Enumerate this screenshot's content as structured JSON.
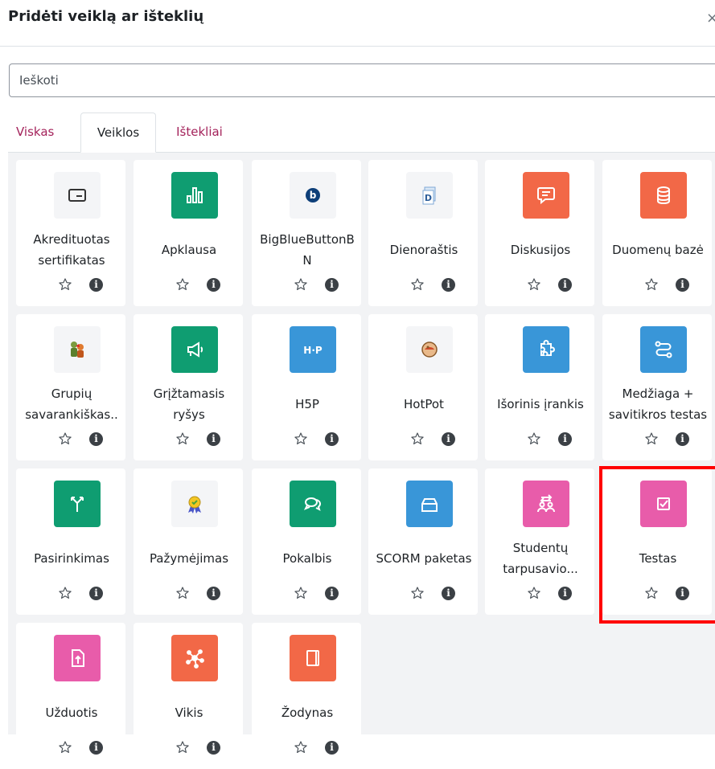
{
  "dialog": {
    "title": "Pridėti veiklą ar išteklių",
    "close_label": "×"
  },
  "search": {
    "placeholder": "Ieškoti"
  },
  "tabs": [
    {
      "label": "Viskas",
      "active": false
    },
    {
      "label": "Veiklos",
      "active": true
    },
    {
      "label": "Ištekliai",
      "active": false
    }
  ],
  "colors": {
    "accent_link": "#a4235b",
    "green": "#0f9d71",
    "blue": "#3996d8",
    "orange": "#f26847",
    "pink": "#e85caa",
    "grey": "#f4f5f7",
    "highlight": "#ff0000"
  },
  "activities": [
    {
      "label": "Akredituotas\nsertifikatas",
      "icon": "certificate-icon",
      "color": "grey"
    },
    {
      "label": "Apklausa",
      "icon": "bar-chart-icon",
      "color": "green"
    },
    {
      "label": "BigBlueButtonB\nN",
      "icon": "bigbluebutton-icon",
      "color": "grey"
    },
    {
      "label": "Dienoraštis",
      "icon": "journal-icon",
      "color": "grey"
    },
    {
      "label": "Diskusijos",
      "icon": "chat-bubble-icon",
      "color": "orange"
    },
    {
      "label": "Duomenų bazė",
      "icon": "database-icon",
      "color": "orange"
    },
    {
      "label": "Grupių\nsavarankiškas..",
      "icon": "group-people-icon",
      "color": "grey"
    },
    {
      "label": "Grįžtamasis\nryšys",
      "icon": "megaphone-icon",
      "color": "green"
    },
    {
      "label": "H5P",
      "icon": "h5p-icon",
      "color": "blue"
    },
    {
      "label": "HotPot",
      "icon": "hotpot-icon",
      "color": "grey"
    },
    {
      "label": "Išorinis įrankis",
      "icon": "puzzle-icon",
      "color": "blue"
    },
    {
      "label": "Medžiaga +\nsavitikros testas",
      "icon": "route-icon",
      "color": "blue"
    },
    {
      "label": "Pasirinkimas",
      "icon": "signpost-icon",
      "color": "green"
    },
    {
      "label": "Pažymėjimas",
      "icon": "badge-icon",
      "color": "grey"
    },
    {
      "label": "Pokalbis",
      "icon": "chat-icon",
      "color": "green"
    },
    {
      "label": "SCORM paketas",
      "icon": "package-icon",
      "color": "blue"
    },
    {
      "label": "Studentų\ntarpusavio...",
      "icon": "peer-review-icon",
      "color": "pink"
    },
    {
      "label": "Testas",
      "icon": "checkbox-icon",
      "color": "pink"
    },
    {
      "label": "Užduotis",
      "icon": "upload-file-icon",
      "color": "pink"
    },
    {
      "label": "Vikis",
      "icon": "network-icon",
      "color": "orange"
    },
    {
      "label": "Žodynas",
      "icon": "book-icon",
      "color": "orange"
    }
  ]
}
